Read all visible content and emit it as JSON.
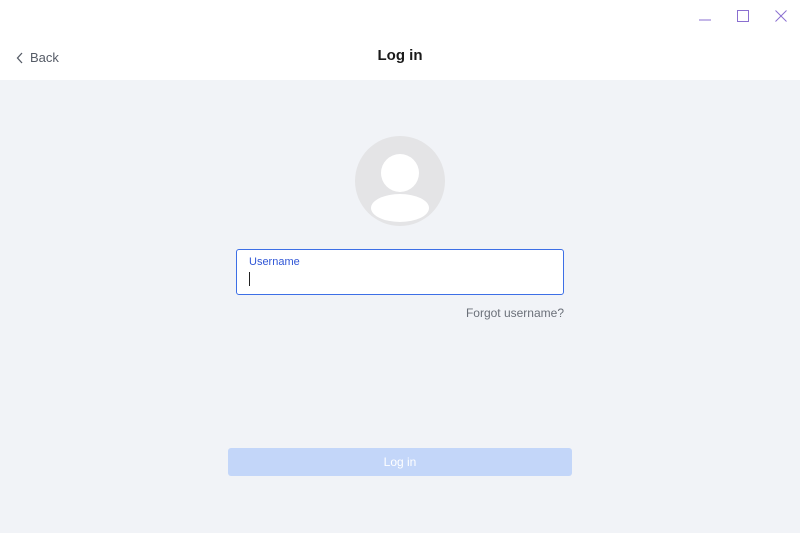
{
  "header": {
    "back_label": "Back",
    "title": "Log in"
  },
  "window_controls": {
    "minimize_icon": "minimize-icon",
    "maximize_icon": "maximize-icon",
    "close_icon": "close-icon",
    "icon_color": "#8a6fd0"
  },
  "form": {
    "avatar_icon": "user-avatar-icon",
    "username_label": "Username",
    "username_value": "",
    "forgot_label": "Forgot username?",
    "login_label": "Log in",
    "accent_color": "#3d6fe6",
    "login_button_color": "#c3d6f9"
  }
}
